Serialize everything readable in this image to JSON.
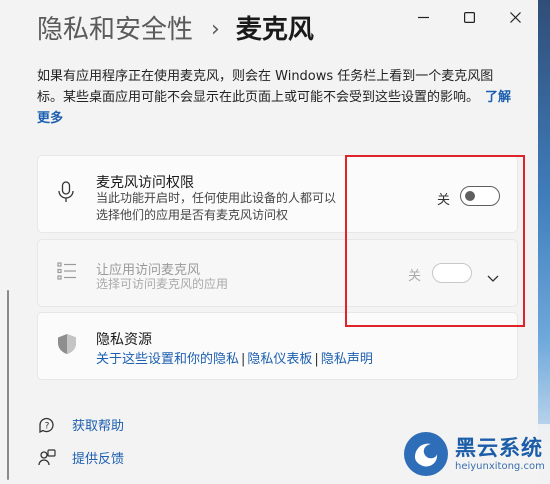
{
  "window": {
    "minimize_icon": "minimize-icon",
    "maximize_icon": "maximize-icon",
    "close_icon": "close-icon"
  },
  "header": {
    "parent": "隐私和安全性",
    "separator": "›",
    "current": "麦克风"
  },
  "intro": {
    "text": "如果有应用程序正在使用麦克风，则会在 Windows 任务栏上看到一个麦克风图标。某些桌面应用可能不会显示在此页面上或可能不会受到这些设置的影响。",
    "link": "了解更多"
  },
  "access_card": {
    "icon": "microphone-icon",
    "title": "麦克风访问权限",
    "description": "当此功能开启时，任何使用此设备的人都可以选择他们的应用是否有麦克风访问权",
    "state": "关",
    "toggle_on": false
  },
  "apps_card": {
    "icon": "app-list-icon",
    "title": "让应用访问麦克风",
    "description": "选择可访问麦克风的应用",
    "state": "关",
    "toggle_on": false,
    "disabled": true
  },
  "privacy_card": {
    "icon": "shield-icon",
    "title": "隐私资源",
    "links": [
      "关于这些设置和你的隐私",
      "隐私仪表板",
      "隐私声明"
    ]
  },
  "help": [
    {
      "icon": "help-icon",
      "label": "获取帮助"
    },
    {
      "icon": "feedback-icon",
      "label": "提供反馈"
    }
  ],
  "watermark": {
    "name": "黑云系统",
    "url": "heiyunxitong.com"
  },
  "colors": {
    "link": "#1d5fb0",
    "highlight_box": "#e0222b",
    "background": "#f3f3f3"
  }
}
